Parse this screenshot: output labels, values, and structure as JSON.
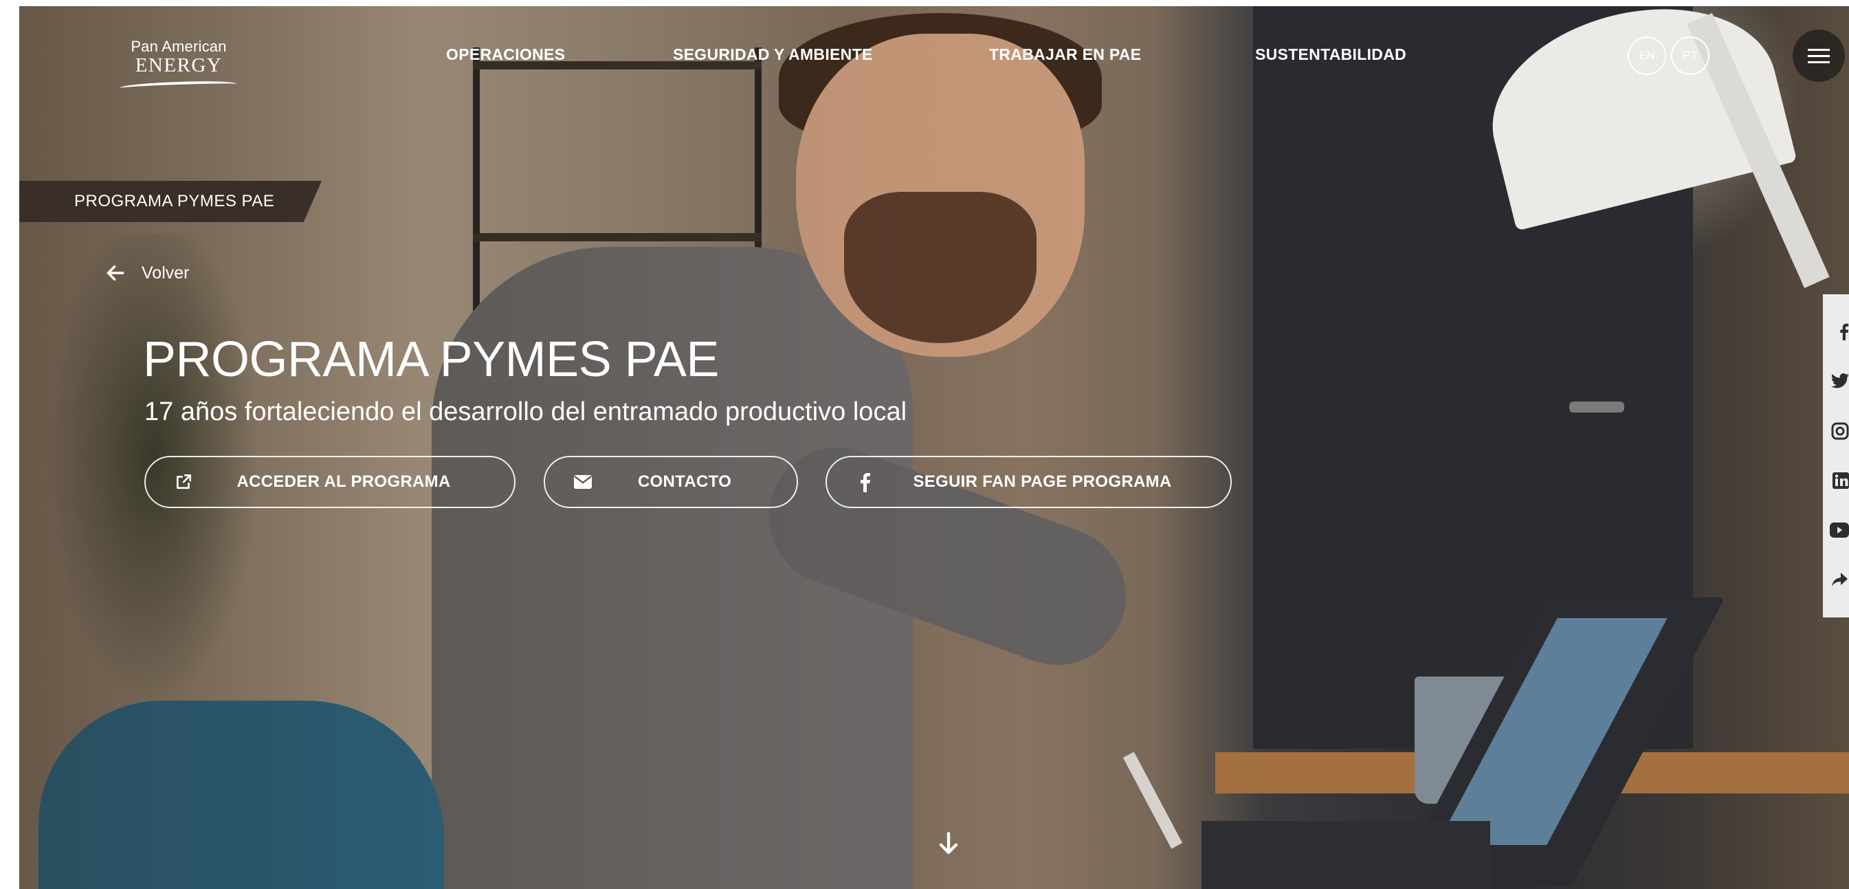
{
  "brand": {
    "logo_line1": "Pan American",
    "logo_line2": "ENERGY"
  },
  "nav": {
    "items": [
      {
        "label": "OPERACIONES"
      },
      {
        "label": "SEGURIDAD Y AMBIENTE"
      },
      {
        "label": "TRABAJAR EN PAE"
      },
      {
        "label": "SUSTENTABILIDAD"
      }
    ],
    "languages": [
      "EN",
      "PT"
    ],
    "menu_icon": "hamburger-icon"
  },
  "section_tag": "PROGRAMA PYMES PAE",
  "back_link": {
    "label": "Volver",
    "icon": "arrow-left-icon"
  },
  "hero": {
    "title": "PROGRAMA PYMES PAE",
    "subtitle": "17 años fortaleciendo el desarrollo del entramado productivo local",
    "buttons": [
      {
        "label": "ACCEDER AL PROGRAMA",
        "icon": "external-link-icon"
      },
      {
        "label": "CONTACTO",
        "icon": "envelope-icon"
      },
      {
        "label": "SEGUIR FAN PAGE PROGRAMA",
        "icon": "facebook-icon"
      }
    ],
    "scroll_icon": "arrow-down-icon"
  },
  "social_rail": {
    "icons": [
      "facebook-icon",
      "twitter-icon",
      "instagram-icon",
      "linkedin-icon",
      "youtube-icon",
      "share-icon"
    ]
  },
  "colors": {
    "text": "#ffffff",
    "tag_background": "#3a2f28",
    "menu_button": "#1e1c1c",
    "rail_background": "#ececec"
  }
}
